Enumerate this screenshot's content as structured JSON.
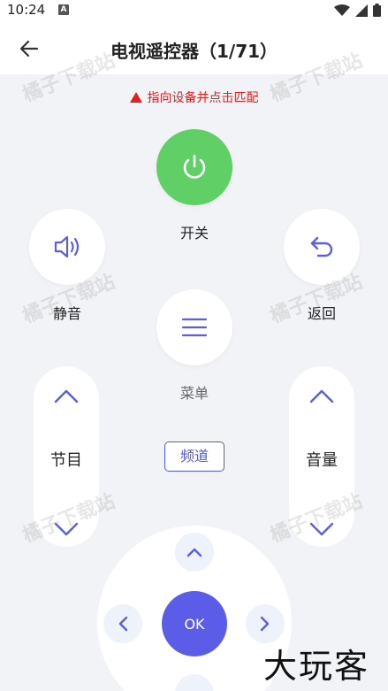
{
  "status": {
    "time": "10:24",
    "notif_icon": "A"
  },
  "appbar": {
    "title": "电视遥控器（1/71）"
  },
  "hint": "指向设备并点击匹配",
  "buttons": {
    "power": "开关",
    "mute": "静音",
    "back": "返回",
    "menu": "菜单",
    "channel": "节目",
    "volume": "音量",
    "freq": "频道",
    "ok": "OK"
  },
  "watermark": "橘子下载站",
  "brand": "大玩客",
  "colors": {
    "accent": "#5b5de8",
    "power": "#5fcf66",
    "hint": "#e22020"
  }
}
